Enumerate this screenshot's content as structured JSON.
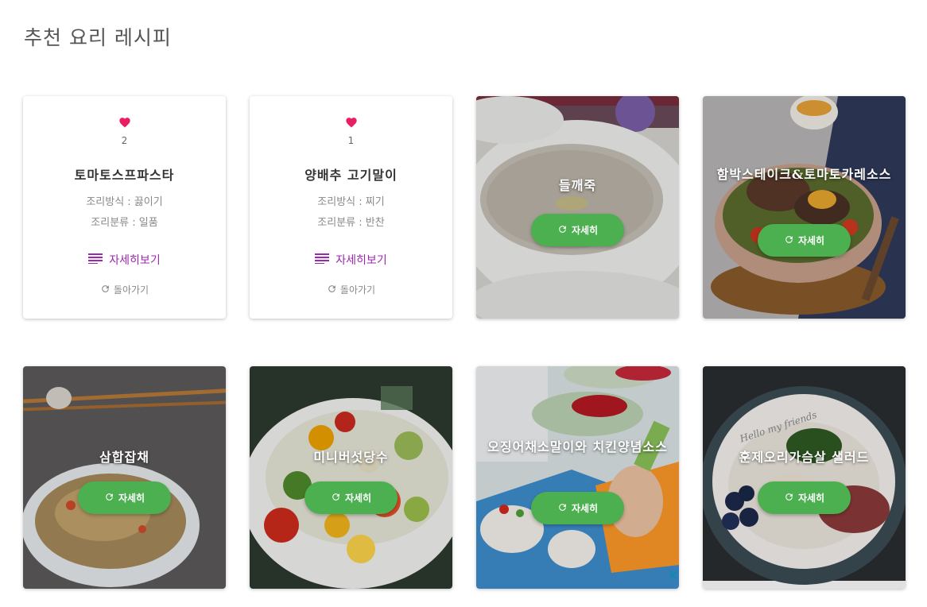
{
  "page_title": "추천 요리 레시피",
  "colors": {
    "heart": "#e91e63",
    "accent_link": "#9c27b0",
    "button": "#4caf50"
  },
  "back_cards": [
    {
      "likes": "2",
      "title": "토마토스프파스타",
      "method": "조리방식 : 끓이기",
      "category": "조리분류 : 일품",
      "detail_label": "자세히보기",
      "back_label": "돌아가기"
    },
    {
      "likes": "1",
      "title": "양배추 고기말이",
      "method": "조리방식 : 찌기",
      "category": "조리분류 : 반찬",
      "detail_label": "자세히보기",
      "back_label": "돌아가기"
    }
  ],
  "photo_cards": [
    {
      "title": "들깨죽",
      "button_label": "자세히"
    },
    {
      "title": "함박스테이크&토마토카레소스",
      "button_label": "자세히"
    },
    {
      "title": "삼합잡채",
      "button_label": "자세히"
    },
    {
      "title": "미니버섯당수",
      "button_label": "자세히"
    },
    {
      "title": "오징어채소말이와 치킨양념소스",
      "button_label": "자세히"
    },
    {
      "title": "훈제오리가슴살 샐러드",
      "button_label": "자세히"
    }
  ]
}
